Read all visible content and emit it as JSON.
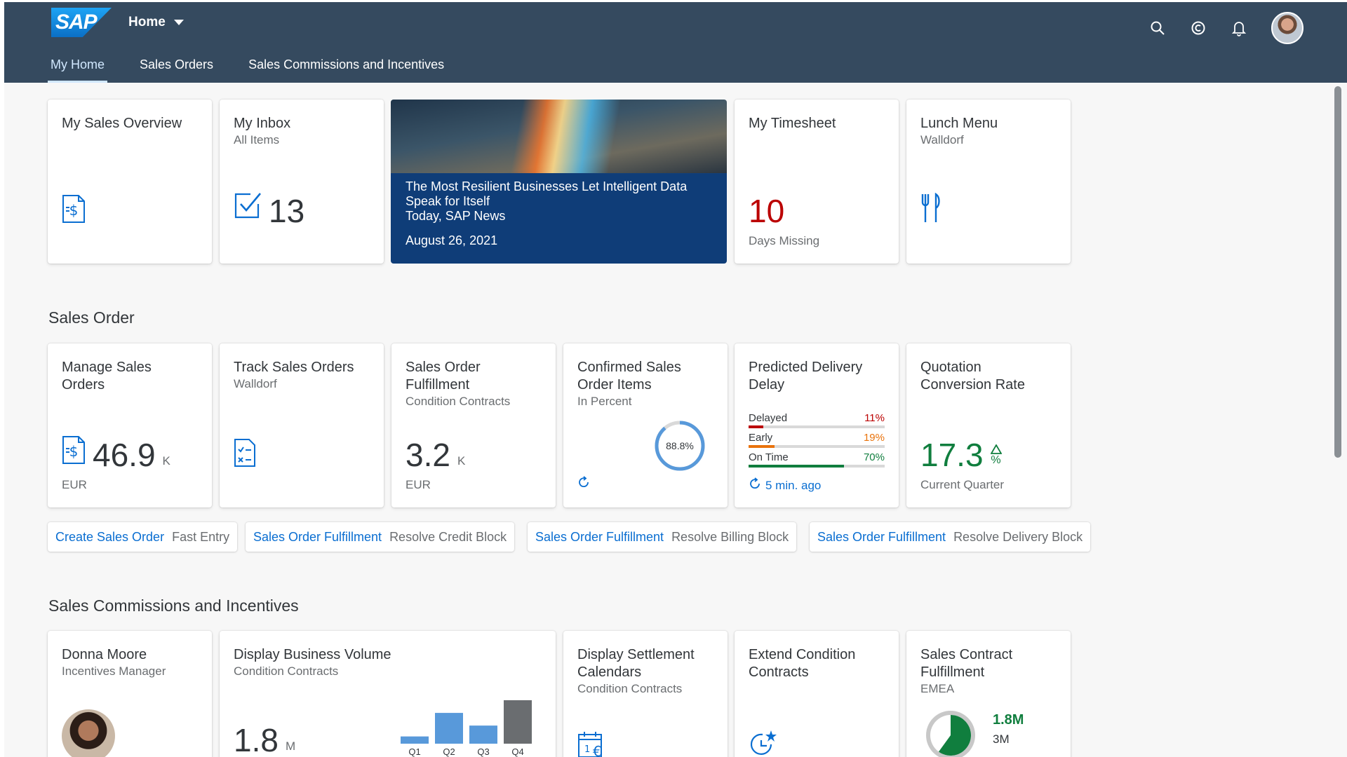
{
  "shell": {
    "logo": "SAP",
    "home_menu": "Home",
    "nav": [
      "My Home",
      "Sales Orders",
      "Sales Commissions and Incentives"
    ]
  },
  "tiles_top": {
    "sales_overview": {
      "title": "My Sales Overview"
    },
    "inbox": {
      "title": "My Inbox",
      "subtitle": "All Items",
      "count": "13"
    },
    "news": {
      "headline": "The Most Resilient Businesses Let Intelligent Data Speak for Itself",
      "source": "Today, SAP News",
      "date": "August 26, 2021"
    },
    "timesheet": {
      "title": "My Timesheet",
      "value": "10",
      "footer": "Days Missing"
    },
    "lunch": {
      "title": "Lunch Menu",
      "subtitle": "Walldorf"
    }
  },
  "sales_order": {
    "section_title": "Sales Order",
    "manage": {
      "title": "Manage Sales Orders",
      "value": "46.9",
      "scale": "K",
      "footer": "EUR"
    },
    "track": {
      "title": "Track Sales Orders",
      "subtitle": "Walldorf"
    },
    "fulfillment": {
      "title": "Sales Order Fulfillment",
      "subtitle": "Condition Contracts",
      "value": "3.2",
      "scale": "K",
      "footer": "EUR"
    },
    "confirmed": {
      "title": "Confirmed Sales Order Items",
      "subtitle": "In Percent",
      "value": "88.8%",
      "fraction": 0.888
    },
    "delivery": {
      "title": "Predicted Delivery Delay",
      "rows": [
        {
          "label": "Delayed",
          "value": "11%",
          "fraction": 0.11,
          "color": "#bb0000"
        },
        {
          "label": "Early",
          "value": "19%",
          "fraction": 0.19,
          "color": "#e9730c"
        },
        {
          "label": "On Time",
          "value": "70%",
          "fraction": 0.7,
          "color": "#107e3e"
        }
      ],
      "refresh": "5 min. ago"
    },
    "quotation": {
      "title": "Quotation Conversion Rate",
      "value": "17.3",
      "unit": "%",
      "footer": "Current Quarter"
    },
    "links": [
      {
        "title": "Create Sales Order",
        "subtitle": "Fast Entry"
      },
      {
        "title": "Sales Order Fulfillment",
        "subtitle": "Resolve Credit Block"
      },
      {
        "title": "Sales Order Fulfillment",
        "subtitle": "Resolve Billing Block"
      },
      {
        "title": "Sales Order Fulfillment",
        "subtitle": "Resolve Delivery Block"
      }
    ]
  },
  "commissions": {
    "section_title": "Sales Commissions and Incentives",
    "person": {
      "name": "Donna Moore",
      "role": "Incentives Manager"
    },
    "business_volume": {
      "title": "Display Business Volume",
      "subtitle": "Condition Contracts",
      "value": "1.8",
      "scale": "M"
    },
    "settlement": {
      "title": "Display Settlement Calendars",
      "subtitle": "Condition Contracts"
    },
    "extend": {
      "title": "Extend Condition Contracts"
    },
    "contract": {
      "title": "Sales Contract Fulfillment",
      "subtitle": "EMEA",
      "value": "1.8M",
      "target": "3M",
      "fraction": 0.6
    }
  },
  "chart_data": {
    "type": "bar",
    "categories": [
      "Q1",
      "Q2",
      "Q3",
      "Q4"
    ],
    "values": [
      0.2,
      0.85,
      0.5,
      1.2
    ],
    "colors": [
      "#5899da",
      "#5899da",
      "#5899da",
      "#6a6d70"
    ]
  },
  "colors": {
    "shell": "#354a5f",
    "link": "#0a6ed1",
    "critical": "#bb0000",
    "positive": "#107e3e"
  }
}
